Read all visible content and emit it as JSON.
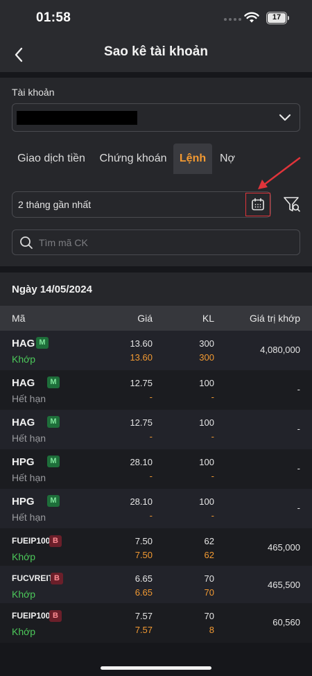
{
  "status_bar": {
    "time": "01:58",
    "battery": "17"
  },
  "nav": {
    "title": "Sao kê tài khoản"
  },
  "account": {
    "label": "Tài khoản"
  },
  "tabs": [
    {
      "label": "Giao dịch tiền"
    },
    {
      "label": "Chứng khoán"
    },
    {
      "label": "Lệnh",
      "active": true
    },
    {
      "label": "Nợ"
    }
  ],
  "filter": {
    "period": "2 tháng gần nhất",
    "search_placeholder": "Tìm mã CK"
  },
  "date_header": "Ngày 14/05/2024",
  "table": {
    "headers": {
      "code": "Mã",
      "price": "Giá",
      "volume": "KL",
      "value": "Giá trị khớp"
    },
    "rows": [
      {
        "code": "HAG",
        "badge": "M",
        "status": "Khớp",
        "price": "13.60",
        "matched_price": "13.60",
        "volume": "300",
        "matched_volume": "300",
        "value": "4,080,000"
      },
      {
        "code": "HAG",
        "badge": "M",
        "status": "Hết hạn",
        "price": "12.75",
        "matched_price": "-",
        "volume": "100",
        "matched_volume": "-",
        "value": "-"
      },
      {
        "code": "HAG",
        "badge": "M",
        "status": "Hết hạn",
        "price": "12.75",
        "matched_price": "-",
        "volume": "100",
        "matched_volume": "-",
        "value": "-"
      },
      {
        "code": "HPG",
        "badge": "M",
        "status": "Hết hạn",
        "price": "28.10",
        "matched_price": "-",
        "volume": "100",
        "matched_volume": "-",
        "value": "-"
      },
      {
        "code": "HPG",
        "badge": "M",
        "status": "Hết hạn",
        "price": "28.10",
        "matched_price": "-",
        "volume": "100",
        "matched_volume": "-",
        "value": "-"
      },
      {
        "code": "FUEIP100",
        "badge": "B",
        "status": "Khớp",
        "price": "7.50",
        "matched_price": "7.50",
        "volume": "62",
        "matched_volume": "62",
        "value": "465,000"
      },
      {
        "code": "FUCVREIT",
        "badge": "B",
        "status": "Khớp",
        "price": "6.65",
        "matched_price": "6.65",
        "volume": "70",
        "matched_volume": "70",
        "value": "465,500"
      },
      {
        "code": "FUEIP100",
        "badge": "B",
        "status": "Khớp",
        "price": "7.57",
        "matched_price": "7.57",
        "volume": "70",
        "matched_volume": "8",
        "value": "60,560"
      }
    ]
  },
  "colors": {
    "accent": "#f39a32",
    "match_green": "#4cc85a",
    "annotation_red": "#e0343a"
  }
}
